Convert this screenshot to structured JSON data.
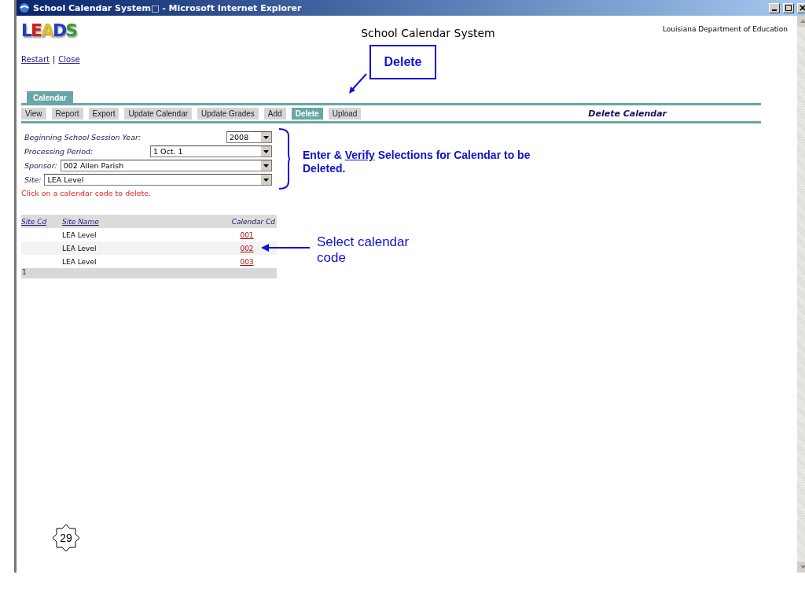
{
  "window": {
    "title": "School Calendar System□ - Microsoft Internet Explorer"
  },
  "header": {
    "logo": "LEADS",
    "title": "School Calendar System",
    "organization": "Louisiana Department of Education"
  },
  "links": [
    "Restart",
    "Close"
  ],
  "link_separator": "|",
  "section_tab": {
    "label": "Calendar"
  },
  "toolbar": [
    {
      "label": "View",
      "selected": false
    },
    {
      "label": "Report",
      "selected": false
    },
    {
      "label": "Export",
      "selected": false
    },
    {
      "label": "Update Calendar",
      "selected": false
    },
    {
      "label": "Update Grades",
      "selected": false
    },
    {
      "label": "Add",
      "selected": false
    },
    {
      "label": "Delete",
      "selected": true
    },
    {
      "label": "Upload",
      "selected": false
    }
  ],
  "page_heading": "Delete Calendar",
  "form": [
    {
      "label": "Beginning School Session Year:",
      "value": "2008"
    },
    {
      "label": "Processing Period:",
      "value": "1 Oct. 1"
    },
    {
      "label": "Sponsor:",
      "value": "002 Allen Parish"
    },
    {
      "label": "Site:",
      "value": "LEA Level"
    }
  ],
  "message": "Click on a calendar code to delete.",
  "table": {
    "columns": [
      "Site Cd",
      "Site Name",
      "Calendar Cd"
    ],
    "rows": [
      {
        "site_name": "LEA Level",
        "calendar_cd": "001"
      },
      {
        "site_name": "LEA Level",
        "calendar_cd": "002"
      },
      {
        "site_name": "LEA Level",
        "calendar_cd": "003"
      }
    ],
    "footer": "1"
  },
  "annotations": {
    "callout": "Delete",
    "instruction_before": "Enter & ",
    "instruction_underlined": "Verify",
    "instruction_after": " Selections for Calendar to be Deleted.",
    "select_note": "Select calendar code",
    "slide_number": "29"
  }
}
